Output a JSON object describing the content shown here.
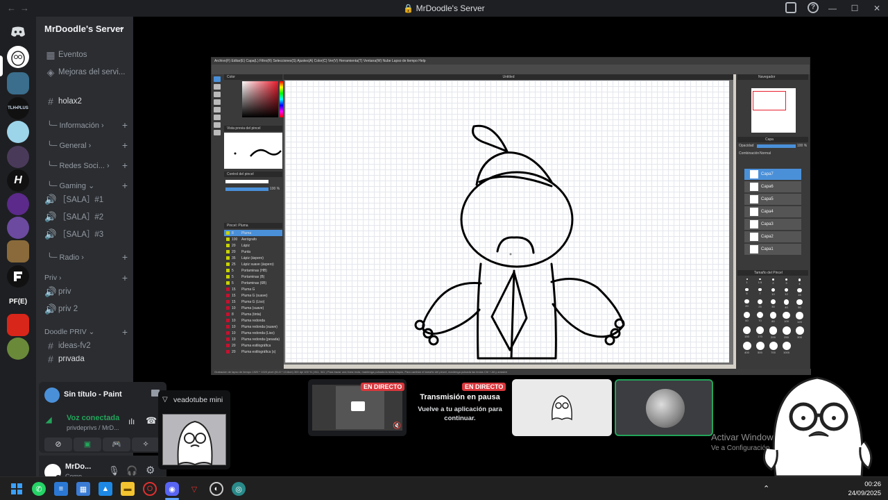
{
  "window": {
    "title": "MrDoodle's Server"
  },
  "server": {
    "name": "MrDoodle's Server"
  },
  "server_rail": {
    "labels": [
      "H",
      "PF(E)"
    ]
  },
  "channels": {
    "eventos": "Eventos",
    "mejoras": "Mejoras del servi...",
    "holax2": "holax2",
    "informacion": "Información",
    "general": "General",
    "redes": "Redes Soci...",
    "gaming": "Gaming",
    "sala1": "［SALA］#1",
    "sala2": "［SALA］#2",
    "sala3": "［SALA］#3",
    "radio": "Radio",
    "cat_priv": "Priv",
    "priv": "priv",
    "priv2": "priv 2",
    "cat_doodle": "Doodle PRIV",
    "ideas": "ideas-fv2",
    "privada": "privada"
  },
  "activity": {
    "title": "Sin título - Paint",
    "voice_status": "Voz conectada",
    "voice_channel": "privdeprivs / MrD..."
  },
  "user": {
    "name": "MrDo...",
    "status": "Comp..."
  },
  "app": {
    "menu": "Archivo(F)  Editar(E)  Capa(L)  Filtro(R)  Selecciones(S)  Ajustes(A)  Color(C)  Ver(V)  Herramienta(T)  Ventana(W)  Nube  Lapso de tiempo  Help",
    "canvas_title": "Untitled",
    "status": "Grabación de lapso de tiempo   1920 * 1920 pixel  (51.8 * 13.8cm)  300 dpi  100 %  ( 811, 341 )  Para trazar una línea recta, mantenga pulsada la tecla Mayús. Para cambiar el tamaño del pincel, mantenga pulsada las teclas Ctrl + Alt y arrastre",
    "panels": {
      "navigator": "Navegador",
      "color": "Color",
      "brush_preview": "Vista previa del pincel",
      "brush_control": "Control del pincel",
      "brush_pen": "Pincel: Pluma",
      "layers": "Capa",
      "opacity_label": "Opacidad",
      "opacity_value": "100 %",
      "blend_label": "Combinación",
      "blend_value": "Normal",
      "brush_size": "Tamaño del Pincel"
    },
    "layers": [
      "Capa7",
      "Capa6",
      "Capa5",
      "Capa4",
      "Capa3",
      "Capa2",
      "Capa1"
    ],
    "brushes": [
      {
        "size": "8",
        "name": "Pluma"
      },
      {
        "size": "100",
        "name": "Aerógrafo"
      },
      {
        "size": "20",
        "name": "Lápiz"
      },
      {
        "size": "20",
        "name": "Punta"
      },
      {
        "size": "35",
        "name": "Lápiz (áspero)"
      },
      {
        "size": "25",
        "name": "Lápiz suave (áspero)"
      },
      {
        "size": "5",
        "name": "Portaminas (HB)"
      },
      {
        "size": "5",
        "name": "Portaminas (B)"
      },
      {
        "size": "5",
        "name": "Portaminas (6B)"
      },
      {
        "size": "15",
        "name": "Pluma G"
      },
      {
        "size": "15",
        "name": "Pluma G (suave)"
      },
      {
        "size": "15",
        "name": "Pluma G (Liso)"
      },
      {
        "size": "10",
        "name": "Pluma (suave)"
      },
      {
        "size": "8",
        "name": "Pluma (tinta)"
      },
      {
        "size": "10",
        "name": "Pluma redonda"
      },
      {
        "size": "10",
        "name": "Pluma redonda (suave)"
      },
      {
        "size": "10",
        "name": "Pluma redonda (Liso)"
      },
      {
        "size": "10",
        "name": "Pluma redonda (pesada)"
      },
      {
        "size": "20",
        "name": "Pluma estilográfica"
      },
      {
        "size": "20",
        "name": "Pluma estilográfica (s)"
      }
    ],
    "brush_sizes": [
      "1",
      "1.5",
      "2",
      "3",
      "4",
      "5",
      "7",
      "10",
      "12",
      "15",
      "20",
      "25",
      "30",
      "40",
      "50",
      "60",
      "70",
      "80",
      "100",
      "120",
      "150",
      "170",
      "200",
      "250",
      "300",
      "400",
      "500",
      "700",
      "1000"
    ],
    "brush_values": {
      "size": "100 %"
    }
  },
  "streams": {
    "live_label": "EN DIRECTO",
    "paused_title": "Transmisión en pausa",
    "paused_sub": "Vuelve a tu aplicación para continuar."
  },
  "veado": {
    "title": "veadotube mini"
  },
  "watermark": {
    "line1": "Activar Windows",
    "line2": "Ve a Configuración"
  },
  "clock": {
    "time": "00:26",
    "date": "24/09/2025"
  },
  "colors": {
    "accent": "#5865f2",
    "live": "#da373c",
    "voice_green": "#23a55a",
    "selected_layer": "#4a90d9"
  }
}
